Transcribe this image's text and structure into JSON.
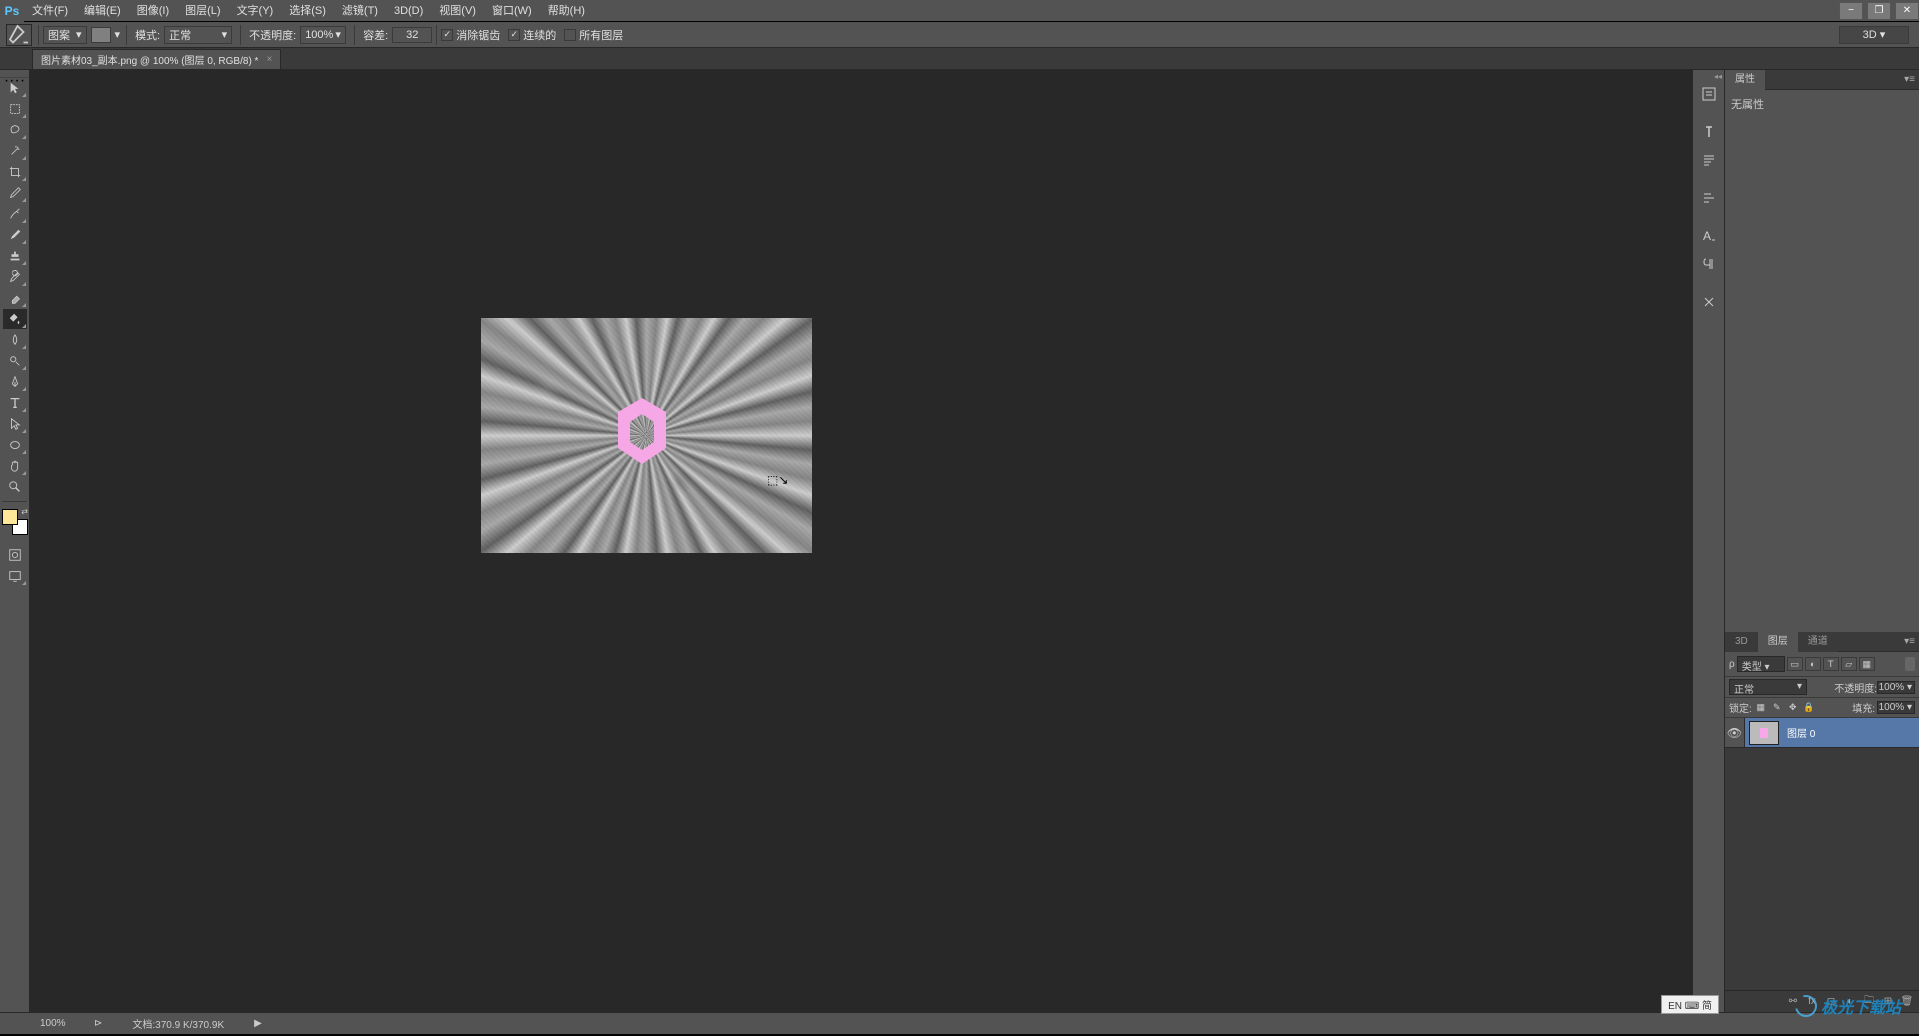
{
  "menu": {
    "items": [
      "文件(F)",
      "编辑(E)",
      "图像(I)",
      "图层(L)",
      "文字(Y)",
      "选择(S)",
      "滤镜(T)",
      "3D(D)",
      "视图(V)",
      "窗口(W)",
      "帮助(H)"
    ]
  },
  "options": {
    "fill_type": "图案",
    "mode_label": "模式:",
    "mode_value": "正常",
    "opacity_label": "不透明度:",
    "opacity_value": "100%",
    "tolerance_label": "容差:",
    "tolerance_value": "32",
    "antialias": "消除锯齿",
    "contiguous": "连续的",
    "all_layers": "所有图层",
    "threed": "3D"
  },
  "document": {
    "tab_title": "图片素材03_副本.png @ 100% (图层 0, RGB/8) *"
  },
  "properties": {
    "tab": "属性",
    "empty": "无属性"
  },
  "layers_panel": {
    "tabs": [
      "3D",
      "图层",
      "通道"
    ],
    "filter_label": "类型",
    "blend_mode": "正常",
    "opacity_label": "不透明度:",
    "opacity_value": "100%",
    "lock_label": "锁定:",
    "fill_label": "填充:",
    "fill_value": "100%",
    "layer0_name": "图层 0"
  },
  "status": {
    "zoom": "100%",
    "doc_size": "文档:370.9 K/370.9K"
  },
  "ime": "EN ⌨ 简",
  "watermark_text": "极光下载站"
}
